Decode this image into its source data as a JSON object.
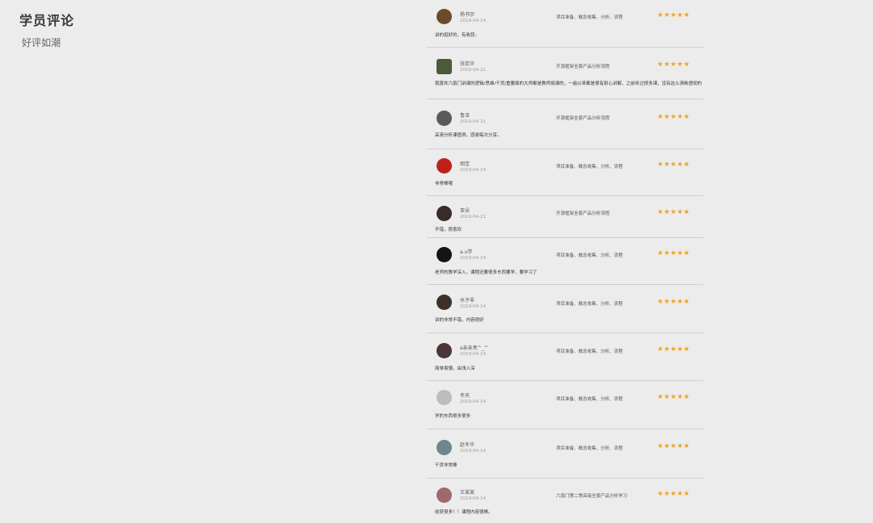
{
  "header": {
    "title": "学员评论",
    "subtitle": "好评如潮"
  },
  "reviews": [
    {
      "name": "杨书宇",
      "date": "2019-04-14",
      "course": "项目准备、概念收集、分析、流程",
      "stars": "★★★★★",
      "comment": "讲的挺好的，有收获。",
      "avatar_color": "#6b4a2c"
    },
    {
      "name": "张蕊华",
      "date": "2019-04-21",
      "course": "开源框架全套产品分析流程",
      "stars": "★★★★★",
      "comment": "我喜欢六扇门讲课的逻辑/思维/干货/重要面的大师都是教师授课的，一遍以来都是很有耐心讲解，之前听过很多课，没有这么清晰透彻的",
      "avatar_color": "#4a5a3a"
    },
    {
      "name": "鲁泽",
      "date": "2019-04-21",
      "course": "开源框架全套产品分析流程",
      "stars": "★★★★★",
      "comment": "高清分析课值得，感谢每次分享。",
      "avatar_color": "#5a5a5a"
    },
    {
      "name": "胡宝",
      "date": "2019-04-14",
      "course": "项目准备、概念收集、分析、流程",
      "stars": "★★★★★",
      "comment": "非常棒哦",
      "avatar_color": "#c0201a"
    },
    {
      "name": "亚朵",
      "date": "2019-04-21",
      "course": "开源框架全套产品分析流程",
      "stars": "★★★★★",
      "comment": "不错，很喜欢",
      "avatar_color": "#3a2a2a"
    },
    {
      "name": "a.u学",
      "date": "2019-04-14",
      "course": "项目准备、概念收集、分析、流程",
      "stars": "★★★★★",
      "comment": "老师的教学深入，课程还要很多东西要学，要学习了",
      "avatar_color": "#141414"
    },
    {
      "name": "水子非",
      "date": "2019-04-14",
      "course": "项目准备、概念收集、分析、流程",
      "stars": "★★★★★",
      "comment": "讲的非常不错，内容很好",
      "avatar_color": "#3c3028"
    },
    {
      "name": "a亲亲亮^_^",
      "date": "2019-04-14",
      "course": "项目准备、概念收集、分析、流程",
      "stars": "★★★★★",
      "comment": "简单易懂，由浅入深",
      "avatar_color": "#4a3636"
    },
    {
      "name": "冬天",
      "date": "2019-04-14",
      "course": "项目准备、概念收集、分析、流程",
      "stars": "★★★★★",
      "comment": "学的东西很多很多",
      "avatar_color": "#bdbdbd"
    },
    {
      "name": "赵冬华",
      "date": "2019-04-14",
      "course": "项目准备、概念收集、分析、流程",
      "stars": "★★★★★",
      "comment": "干货非常棒",
      "avatar_color": "#6f8590"
    },
    {
      "name": "王某某",
      "date": "2019-04-14",
      "course": "六扇门第二季高级全套产品分析学习",
      "stars": "★★★★★",
      "comment": "收获很多！！课程内容很棒。",
      "avatar_color": "#a06a6a"
    }
  ]
}
